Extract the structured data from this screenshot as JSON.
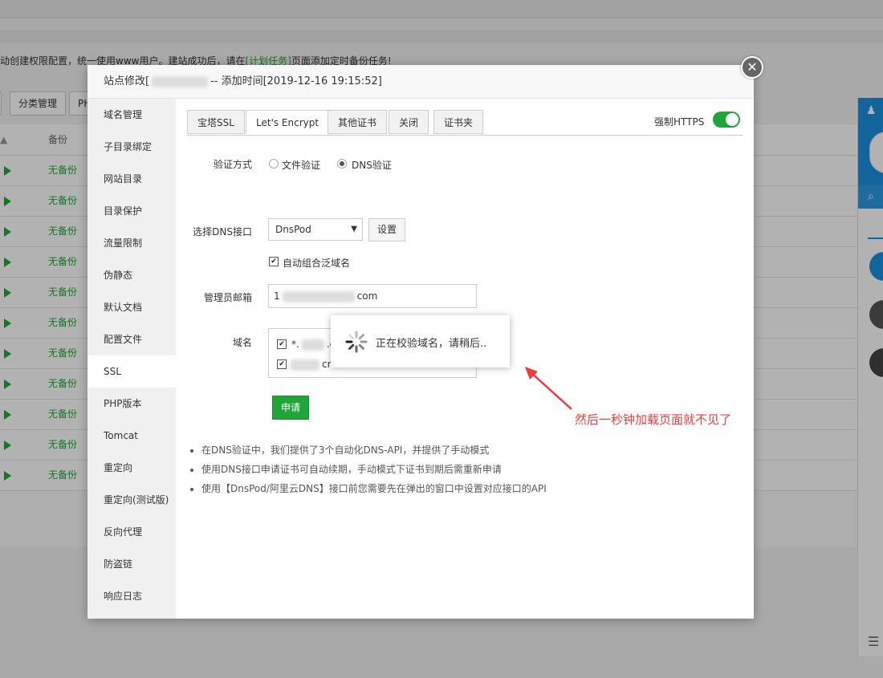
{
  "background": {
    "notice_prefix": "动创建权限配置，统一使用www用户。建站成功后，请在",
    "notice_link": "[计划任务]",
    "notice_suffix": "页面添加定时备份任务!",
    "toolbar_category": "分类管理",
    "toolbar_php": "PH",
    "column_backup": "备份",
    "row_status": "无备份",
    "row_count": 11
  },
  "modal": {
    "title_prefix": "站点修改[",
    "title_suffix": "-- 添加时间[2019-12-16 19:15:52]",
    "close_glyph": "✕",
    "menu": [
      "域名管理",
      "子目录绑定",
      "网站目录",
      "目录保护",
      "流量限制",
      "伪静态",
      "默认文档",
      "配置文件",
      "SSL",
      "PHP版本",
      "Tomcat",
      "重定向",
      "重定向(测试版)",
      "反向代理",
      "防盗链",
      "响应日志"
    ],
    "active_menu": "SSL"
  },
  "ssl": {
    "tabs": [
      "宝塔SSL",
      "Let's Encrypt",
      "其他证书",
      "关闭",
      "证书夹"
    ],
    "active_tab": "Let's Encrypt",
    "force_https_label": "强制HTTPS",
    "force_https_on": true,
    "verify_label": "验证方式",
    "verify_options": [
      "文件验证",
      "DNS验证"
    ],
    "verify_selected": "DNS验证",
    "dns_label": "选择DNS接口",
    "dns_value": "DnsPod",
    "dns_settings_button": "设置",
    "wildcard_label": "自动组合泛域名",
    "email_label": "管理员邮箱",
    "email_value_prefix": "1",
    "email_value_suffix": "com",
    "domain_label": "域名",
    "domains": [
      {
        "prefix": "*.",
        "suffix": ".cn"
      },
      {
        "prefix": "",
        "suffix": "cn"
      }
    ],
    "apply_button": "申请",
    "tips": [
      "在DNS验证中，我们提供了3个自动化DNS-API，并提供了手动模式",
      "使用DNS接口申请证书可自动续期，手动模式下证书到期后需重新申请",
      "使用【DnsPod/阿里云DNS】接口前您需要先在弹出的窗口中设置对应接口的API"
    ]
  },
  "loading": {
    "text": "正在校验域名，请稍后.."
  },
  "annotation": {
    "text": "然后一秒钟加载页面就不见了",
    "color": "#f03c3c"
  },
  "colors": {
    "brand_green": "#20a53a",
    "side_blue": "#1c8fe0"
  }
}
